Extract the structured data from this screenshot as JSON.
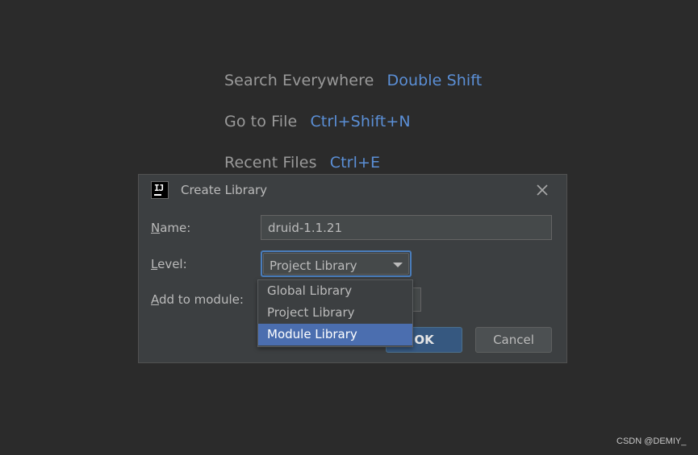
{
  "hints": [
    {
      "label": "Search Everywhere",
      "key": "Double Shift"
    },
    {
      "label": "Go to File",
      "key": "Ctrl+Shift+N"
    },
    {
      "label": "Recent Files",
      "key": "Ctrl+E"
    }
  ],
  "dialog": {
    "app_icon_text": "IJ",
    "title": "Create Library",
    "name_label": {
      "mnemonic": "N",
      "rest": "ame:"
    },
    "name_value": "druid-1.1.21",
    "level_label": {
      "mnemonic": "L",
      "rest": "evel:"
    },
    "level_selected": "Project Library",
    "module_label": {
      "mnemonic": "A",
      "rest": "dd to module:"
    },
    "ok_label": "OK",
    "cancel_label": "Cancel"
  },
  "level_options": [
    {
      "label": "Global Library"
    },
    {
      "label": "Project Library"
    },
    {
      "label": "Module Library"
    }
  ],
  "highlighted_option": "Module Library",
  "watermark": "CSDN @DEMIY_",
  "colors": {
    "background": "#2b2b2b",
    "dialog": "#3c3f41",
    "accent_blue": "#5b8fd6",
    "selection": "#4b6eaf",
    "focus_border": "#4a7dbb"
  }
}
